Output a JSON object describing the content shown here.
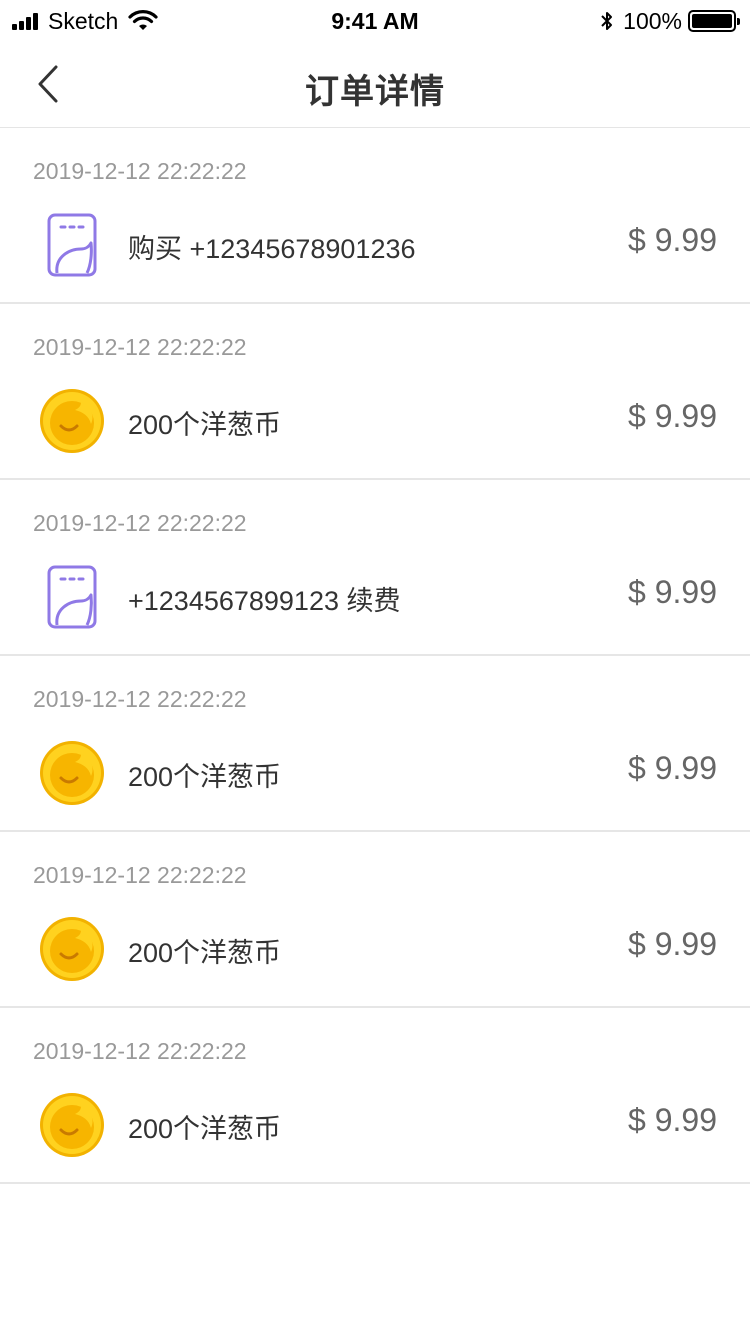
{
  "status_bar": {
    "carrier": "Sketch",
    "time": "9:41 AM",
    "battery_text": "100%"
  },
  "nav": {
    "title": "订单详情",
    "back_icon": "chevron-left-icon"
  },
  "orders": [
    {
      "date": "2019-12-12 22:22:22",
      "icon": "sim-card-icon",
      "name": "购买 +12345678901236",
      "price": "$ 9.99"
    },
    {
      "date": "2019-12-12 22:22:22",
      "icon": "onion-coin-icon",
      "name": "200个洋葱币",
      "price": "$ 9.99"
    },
    {
      "date": "2019-12-12 22:22:22",
      "icon": "sim-card-icon",
      "name": "+1234567899123 续费",
      "price": "$ 9.99"
    },
    {
      "date": "2019-12-12 22:22:22",
      "icon": "onion-coin-icon",
      "name": "200个洋葱币",
      "price": "$ 9.99"
    },
    {
      "date": "2019-12-12 22:22:22",
      "icon": "onion-coin-icon",
      "name": "200个洋葱币",
      "price": "$ 9.99"
    },
    {
      "date": "2019-12-12 22:22:22",
      "icon": "onion-coin-icon",
      "name": "200个洋葱币",
      "price": "$ 9.99"
    }
  ],
  "colors": {
    "sim_icon": "#8f79e6",
    "coin_outer": "#f5b800",
    "coin_inner": "#ffd21f",
    "date_text": "#999999",
    "price_text": "#666666",
    "divider": "#e6e6e6"
  }
}
